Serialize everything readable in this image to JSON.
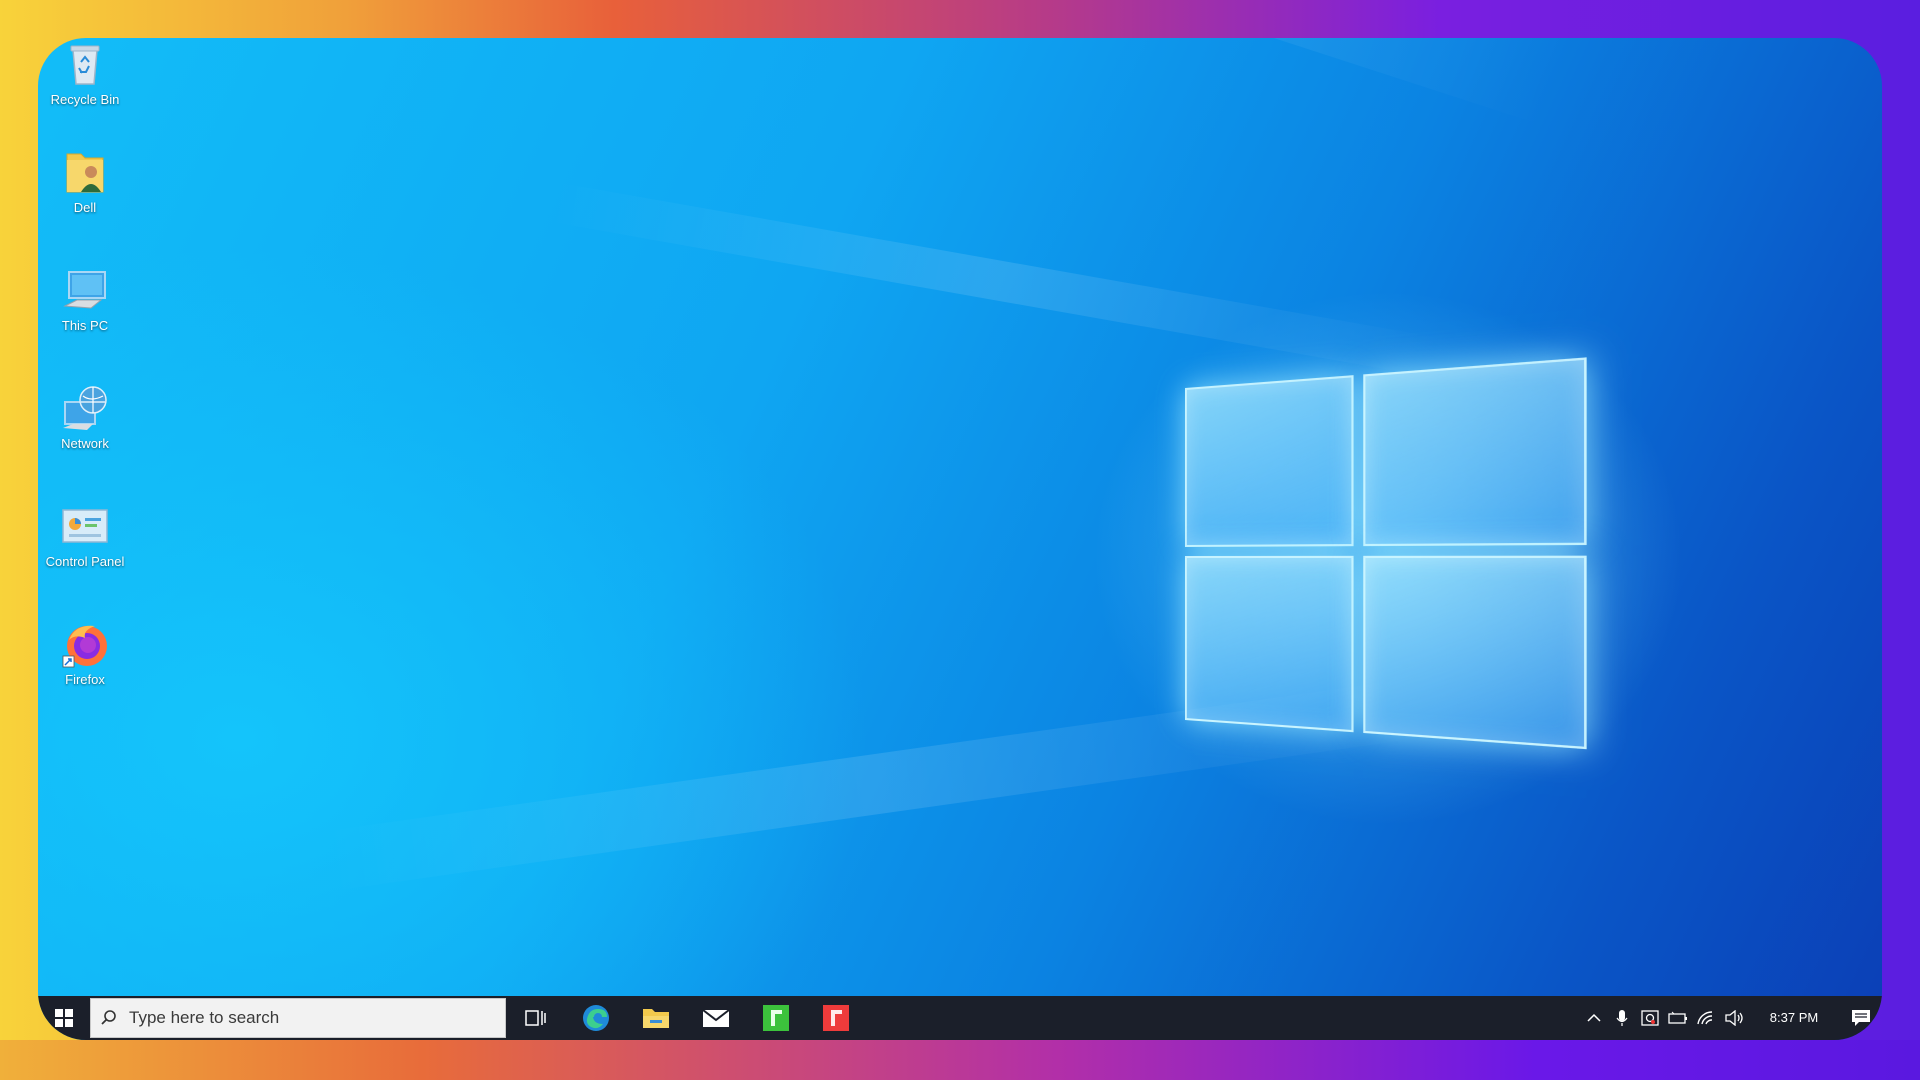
{
  "desktop": {
    "icons": [
      {
        "label": "Recycle Bin",
        "icon": "recycle-bin-icon"
      },
      {
        "label": "Dell",
        "icon": "user-folder-icon"
      },
      {
        "label": "This PC",
        "icon": "computer-icon"
      },
      {
        "label": "Network",
        "icon": "network-icon"
      },
      {
        "label": "Control Panel",
        "icon": "control-panel-icon"
      },
      {
        "label": "Firefox",
        "icon": "firefox-icon"
      }
    ]
  },
  "taskbar": {
    "search_placeholder": "Type here to search",
    "apps": [
      "task-view-icon",
      "edge-icon",
      "file-explorer-icon",
      "mail-icon",
      "green-app-icon",
      "red-app-icon"
    ],
    "tray_icons": [
      "show-hidden-icons-chevron",
      "microphone-icon",
      "defender-icon",
      "battery-icon",
      "wifi-icon",
      "volume-icon"
    ],
    "clock_time": "8:37 PM",
    "notification_icon": "action-center-icon"
  },
  "colors": {
    "wallpaper_primary": "#12bdf8",
    "wallpaper_deep": "#0b3fb6",
    "taskbar": "#1b1f2a"
  }
}
